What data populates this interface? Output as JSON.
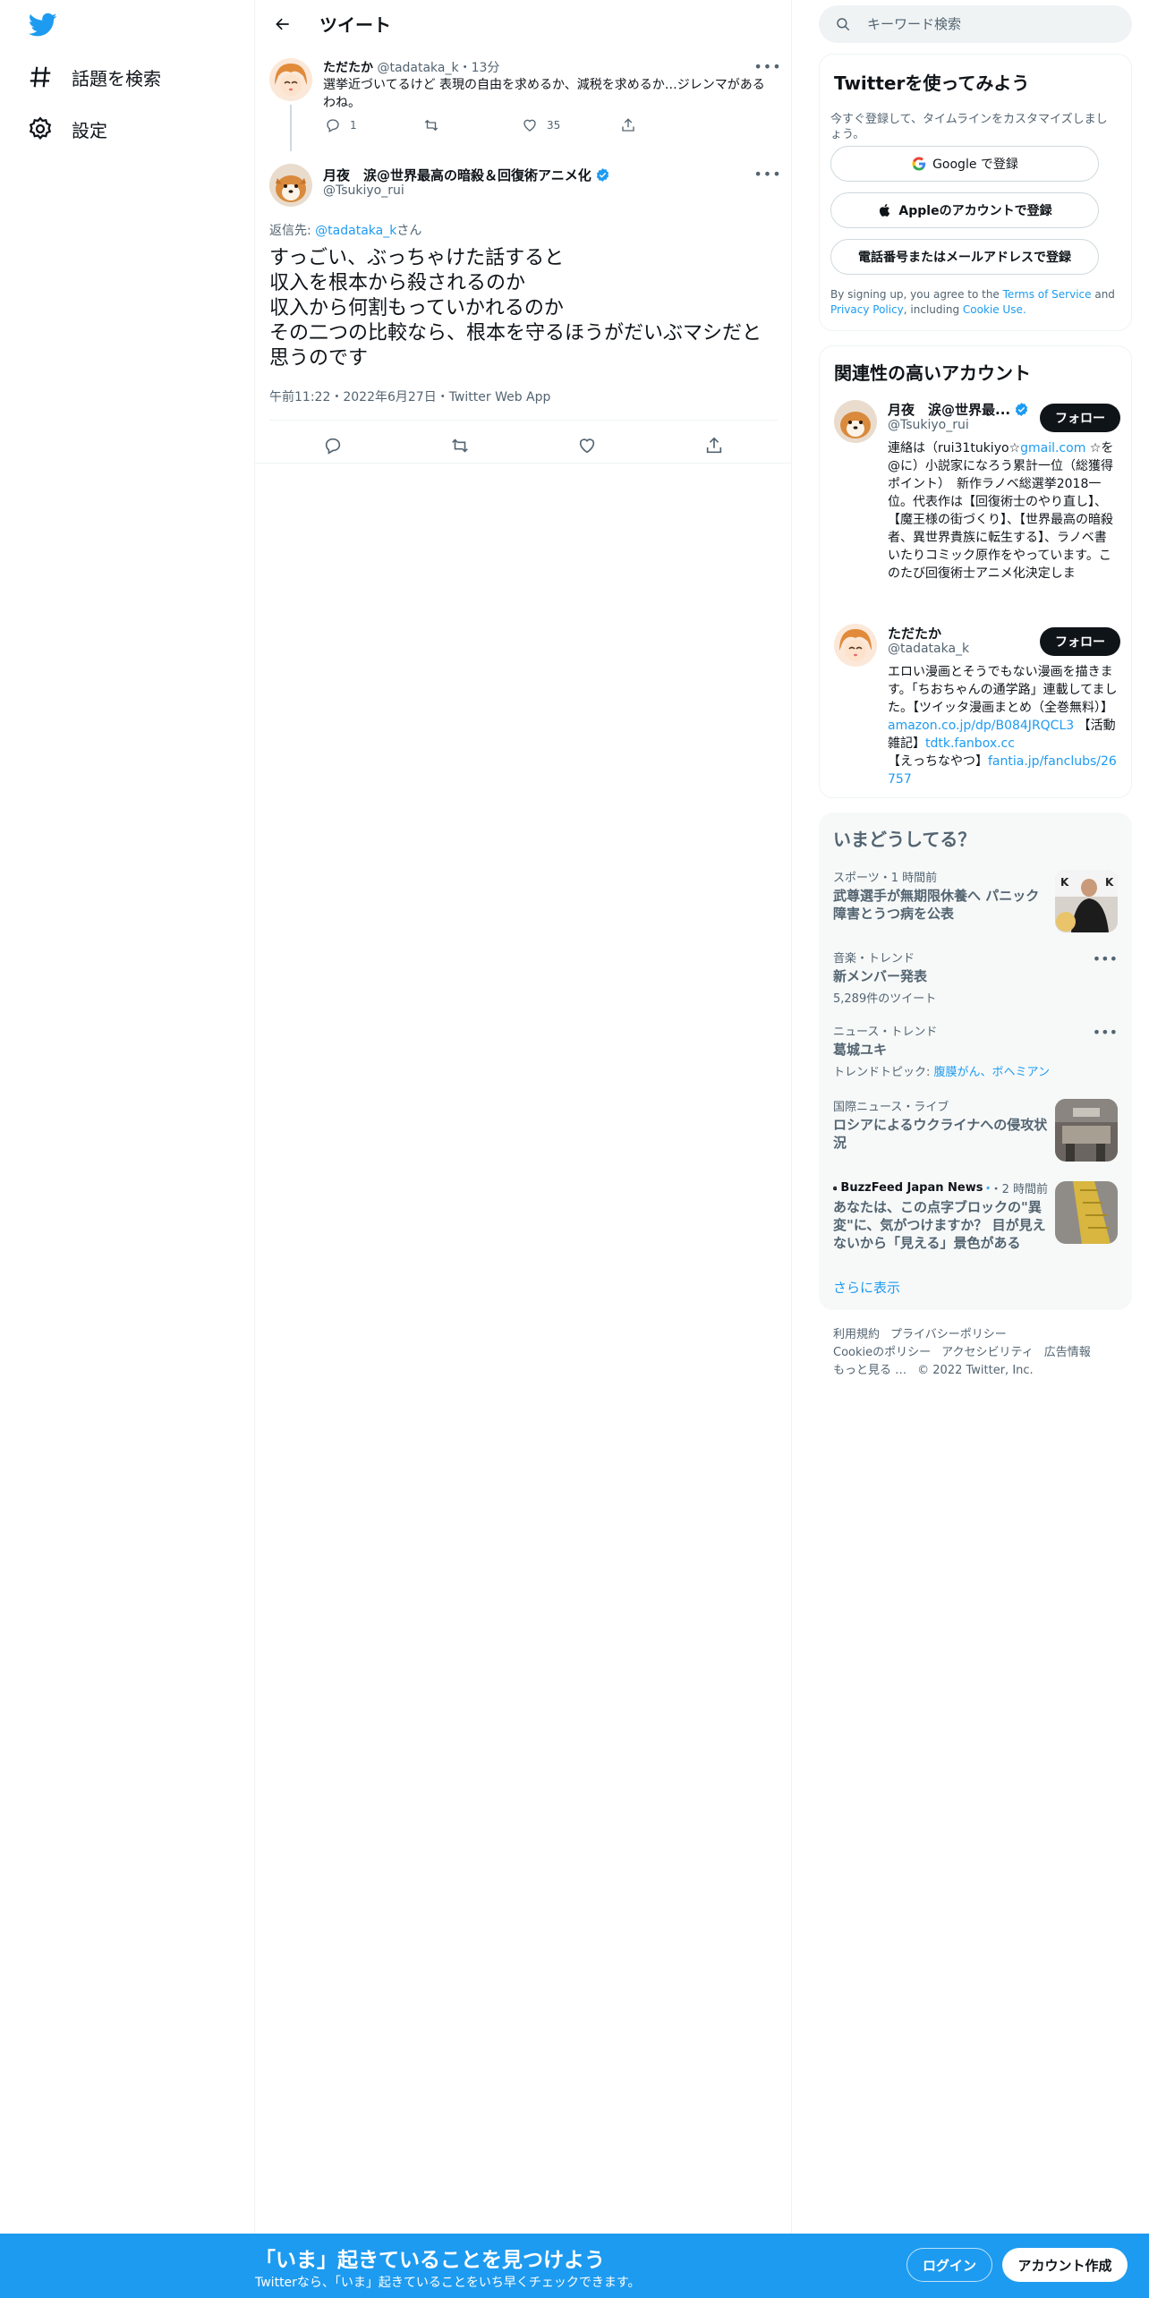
{
  "nav": {
    "explore_label": "話題を検索",
    "settings_label": "設定"
  },
  "header": {
    "title": "ツイート"
  },
  "parent_tweet": {
    "name": "ただたか",
    "handle": "@tadataka_k",
    "time": "13分",
    "text": "選挙近づいてるけど 表現の自由を求めるか、減税を求めるか…ジレンマがあるわね。",
    "reply_count": "1",
    "retweet_count": "",
    "like_count": "35"
  },
  "main_tweet": {
    "name": "月夜　涙@世界最高の暗殺＆回復術アニメ化",
    "handle": "@Tsukiyo_rui",
    "reply_prefix": "返信先: ",
    "reply_to": "@tadataka_k",
    "reply_suffix": "さん",
    "lines": [
      "すっごい、ぶっちゃけた話すると",
      "収入を根本から殺されるのか",
      "収入から何割もっていかれるのか",
      "その二つの比較なら、根本を守るほうがだいぶマシだと思うのです"
    ],
    "meta": "午前11:22・2022年6月27日・Twitter Web App"
  },
  "search": {
    "placeholder": "キーワード検索"
  },
  "signup_card": {
    "title": "Twitterを使ってみよう",
    "subtitle": "今すぐ登録して、タイムラインをカスタマイズしましょう。",
    "google_label": "Google で登録",
    "apple_label": "Appleのアカウントで登録",
    "phone_label": "電話番号またはメールアドレスで登録",
    "terms_prefix": "By signing up, you agree to the ",
    "terms_link": "Terms of Service",
    "terms_and": " and ",
    "privacy_link": "Privacy Policy",
    "terms_including": ", including ",
    "cookie_link": "Cookie Use."
  },
  "related": {
    "title": "関連性の高いアカウント",
    "accounts": [
      {
        "name": "月夜　涙@世界最...",
        "handle": "@Tsukiyo_rui",
        "follow_label": "フォロー",
        "bio_a": "連絡は（rui31tukiyo☆",
        "bio_link": "gmail.com",
        "bio_b": " ☆を@に）小説家になろう累計一位（総獲得ポイント）　新作ラノベ総選挙2018一位。代表作は【回復術士のやり直し】、【魔王様の街づくり】、【世界最高の暗殺者、異世界貴族に転生する】、ラノベ書いたりコミック原作をやっています。このたび回復術士アニメ化決定しま"
      },
      {
        "name": "ただたか",
        "handle": "@tadataka_k",
        "follow_label": "フォロー",
        "bio_a": "エロい漫画とそうでもない漫画を描きます。「ちおちゃんの通学路」連載してました。【ツイッタ漫画まとめ（全巻無料）】",
        "bio_link1": "amazon.co.jp/dp/B084JRQCL3",
        "bio_b": " 【活動雑記】",
        "bio_link2": "tdtk.fanbox.cc",
        "bio_c": " 【えっちなやつ】",
        "bio_link3": "fantia.jp/fanclubs/26757"
      }
    ]
  },
  "trends": {
    "title": "いまどうしてる？",
    "items": [
      {
        "context": "スポーツ・1 時間前",
        "title": "武尊選手が無期限休養へ パニック障害とうつ病を公表"
      },
      {
        "context": "音楽・トレンド",
        "title": "新メンバー発表",
        "count": "5,289件のツイート"
      },
      {
        "context": "ニュース・トレンド",
        "title": "葛城ユキ",
        "topics_prefix": "トレンドトピック: ",
        "topics": "腹膜がん、ボヘミアン"
      },
      {
        "context": "国際ニュース・ライブ",
        "title": "ロシアによるウクライナへの侵攻状況"
      },
      {
        "source": "BuzzFeed Japan News",
        "time": "・2 時間前",
        "title": "あなたは、この点字ブロックの\"異変\"に、気がつけますか？ 目が見えないから「見える」景色がある"
      }
    ],
    "show_more": "さらに表示"
  },
  "footer": {
    "links": [
      "利用規約",
      "プライバシーポリシー",
      "Cookieのポリシー",
      "アクセシビリティ",
      "広告情報",
      "もっと見る …"
    ],
    "copyright": "© 2022 Twitter, Inc."
  },
  "bottom_bar": {
    "headline": "「いま」起きていることを見つけよう",
    "sub": "Twitterなら、「いま」起きていることをいち早くチェックできます。",
    "login_label": "ログイン",
    "signup_label": "アカウント作成"
  },
  "colors": {
    "accent": "#1d9bf0",
    "text": "#0f1419",
    "muted": "#536471"
  }
}
